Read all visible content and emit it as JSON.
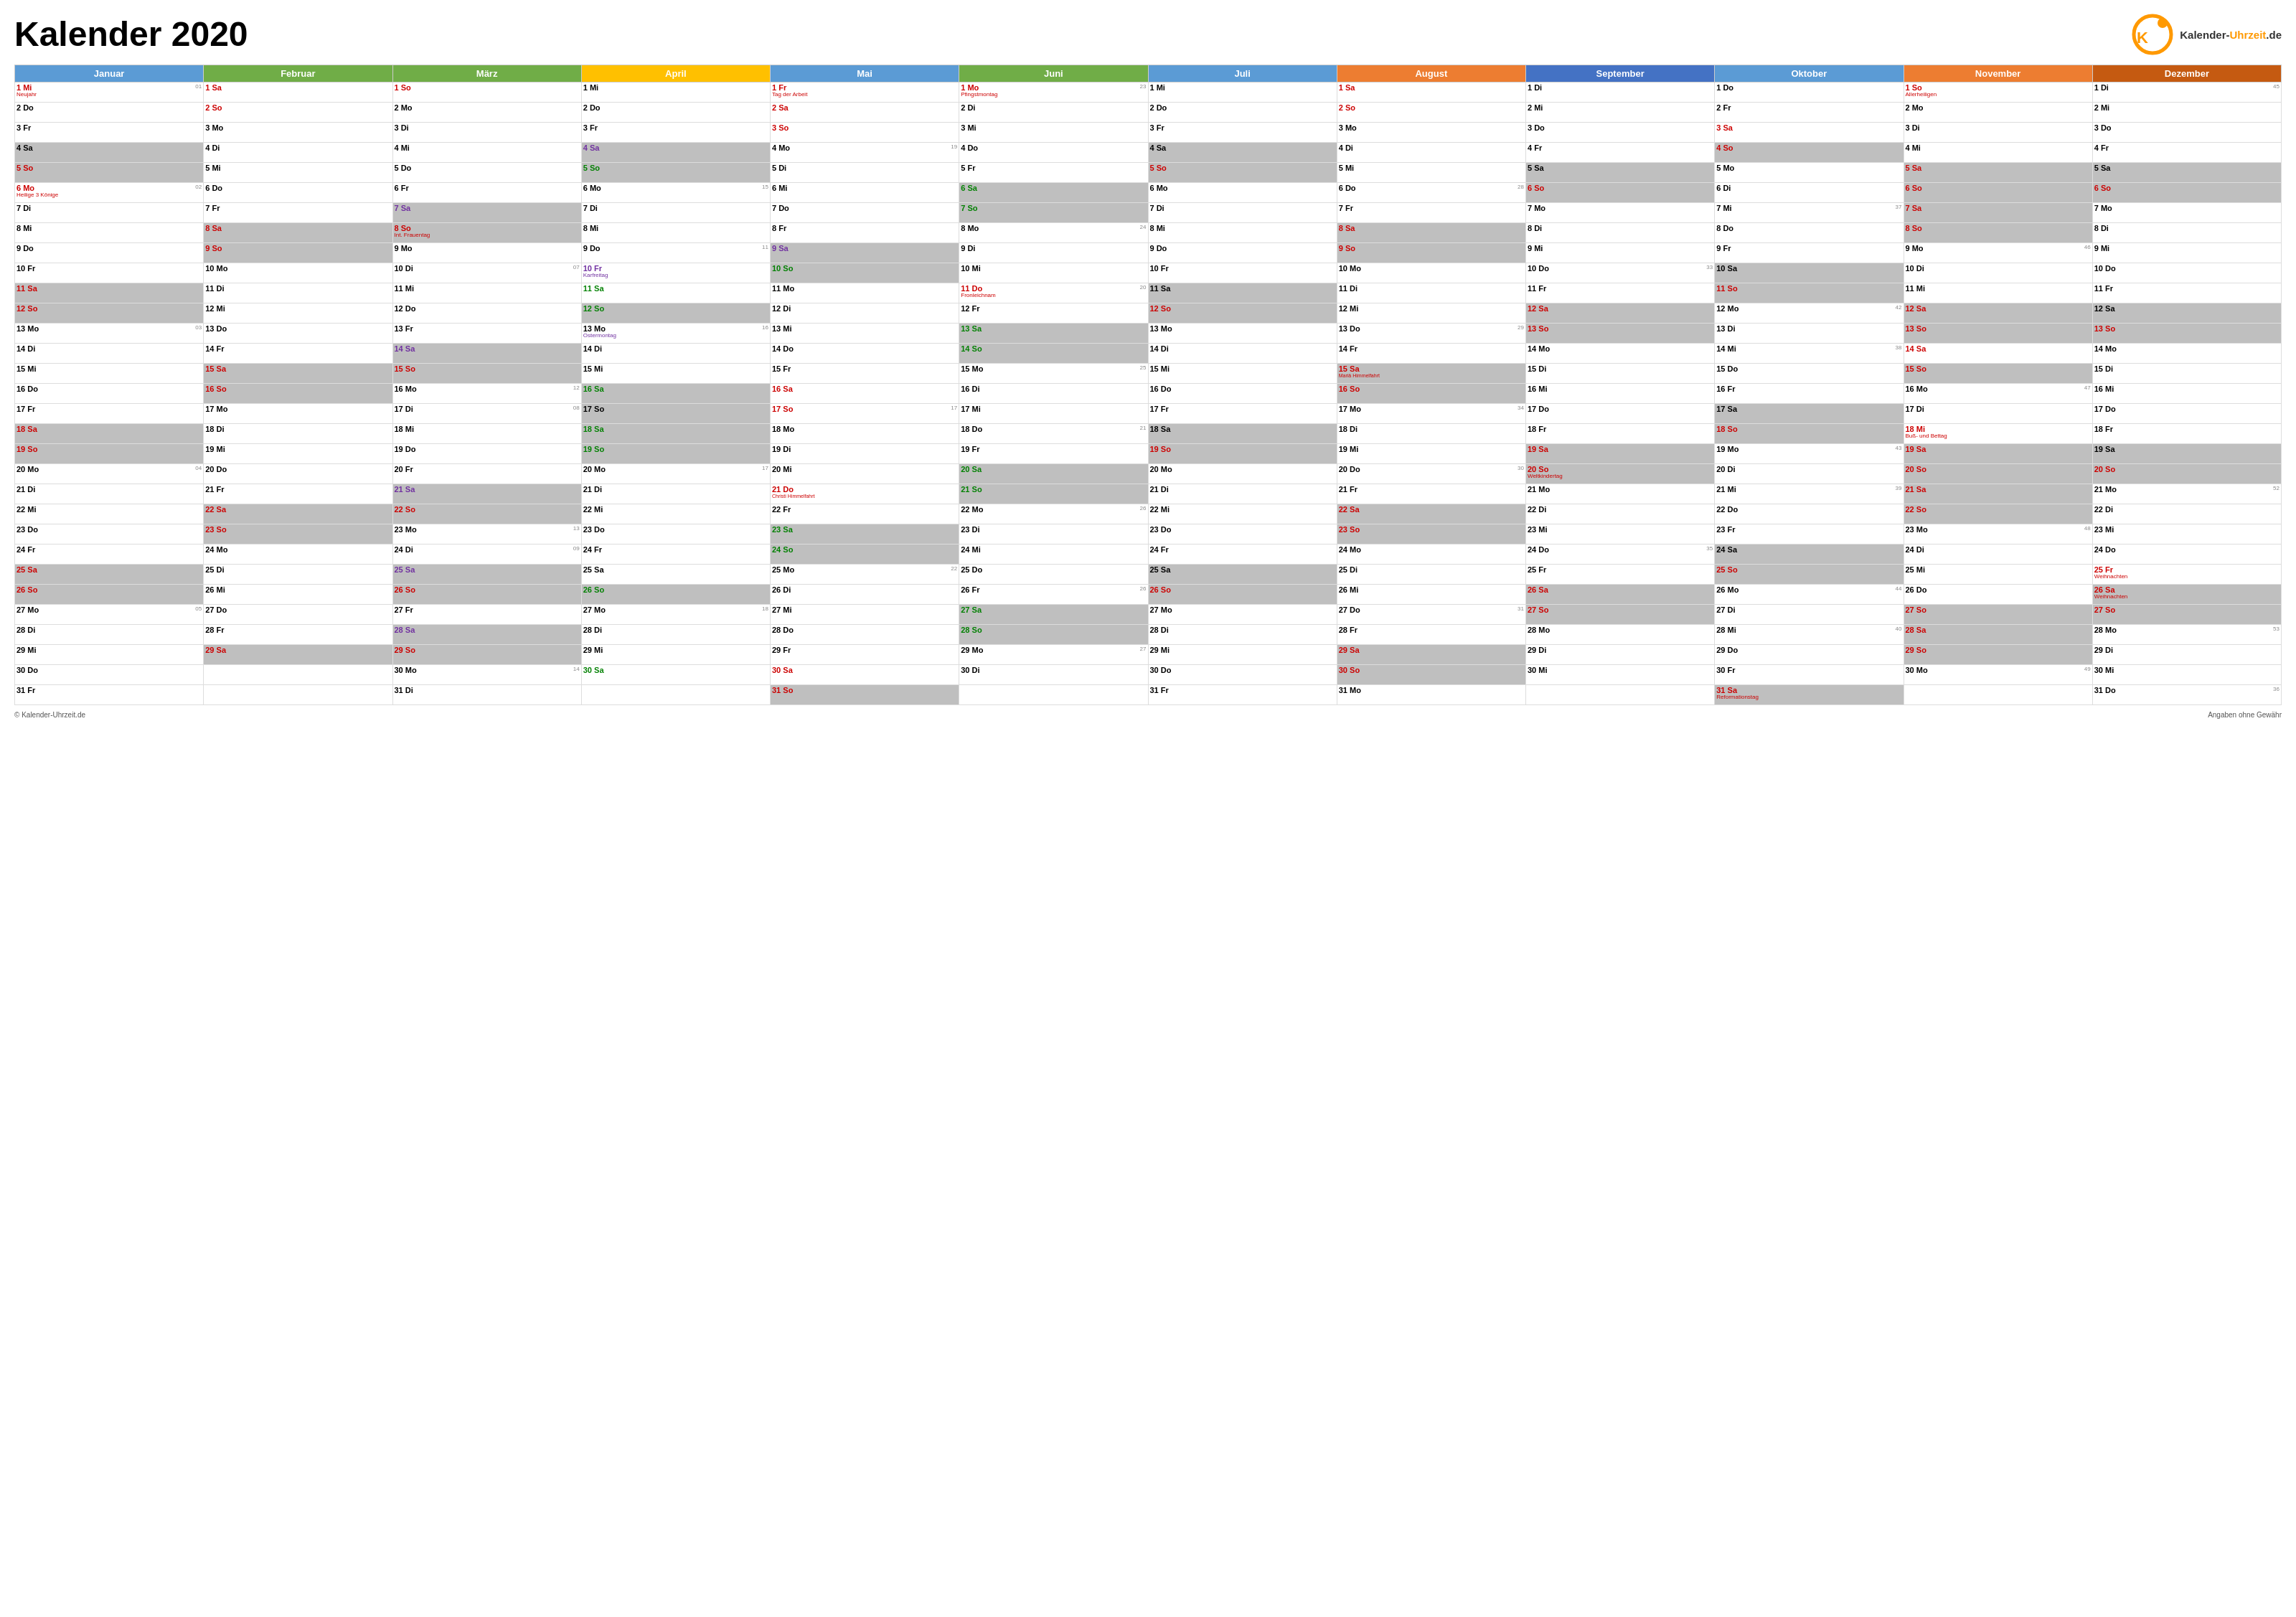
{
  "title": "Kalender 2020",
  "logo": {
    "site": "Kalender-Uhrzeit.de"
  },
  "footer": {
    "left": "© Kalender-Uhrzeit.de",
    "right": "Angaben ohne Gewähr"
  },
  "months": [
    {
      "label": "Januar",
      "class": "th-jan"
    },
    {
      "label": "Februar",
      "class": "th-feb"
    },
    {
      "label": "März",
      "class": "th-mar"
    },
    {
      "label": "April",
      "class": "th-apr"
    },
    {
      "label": "Mai",
      "class": "th-mai"
    },
    {
      "label": "Juni",
      "class": "th-jun"
    },
    {
      "label": "Juli",
      "class": "th-jul"
    },
    {
      "label": "August",
      "class": "th-aug"
    },
    {
      "label": "September",
      "class": "th-sep"
    },
    {
      "label": "Oktober",
      "class": "th-okt"
    },
    {
      "label": "November",
      "class": "th-nov"
    },
    {
      "label": "Dezember",
      "class": "th-dez"
    }
  ]
}
